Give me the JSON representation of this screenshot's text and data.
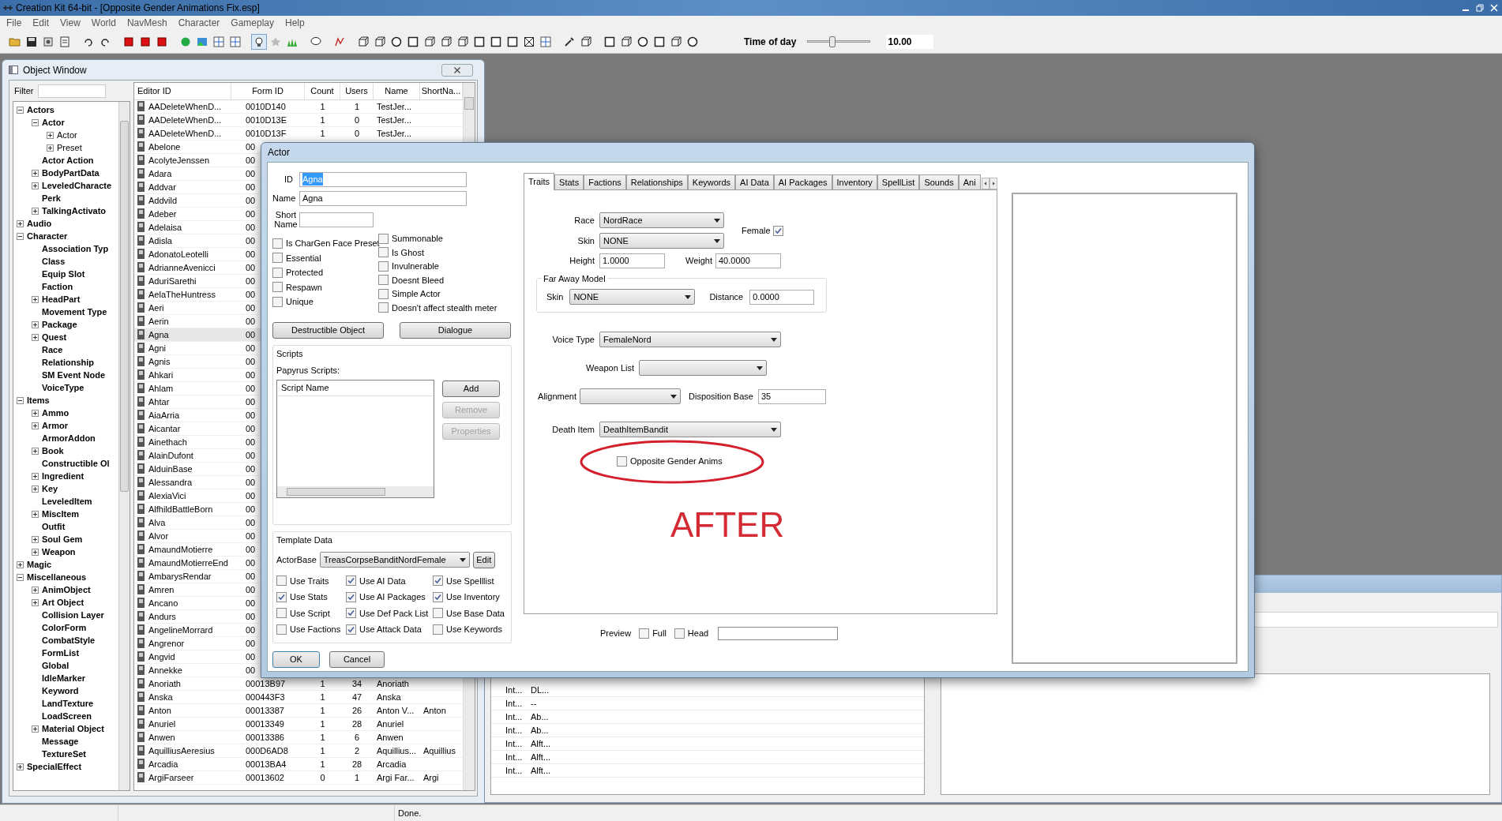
{
  "window": {
    "title": "Creation Kit 64-bit - [Opposite Gender Animations Fix.esp]"
  },
  "menu": [
    "File",
    "Edit",
    "View",
    "World",
    "NavMesh",
    "Character",
    "Gameplay",
    "Help"
  ],
  "toolbar": {
    "time_label": "Time of day",
    "time_slider": {
      "level": 0.4
    },
    "time_value": "10.00"
  },
  "object_window": {
    "title": "Object Window",
    "filter_label": "Filter",
    "tree": [
      {
        "label": "Actors",
        "expanded": true,
        "children": [
          {
            "label": "Actor",
            "expanded": true,
            "children": [
              {
                "label": "Actor",
                "expanded": false
              },
              {
                "label": "Preset",
                "expanded": false
              }
            ]
          },
          {
            "label": "Actor Action"
          },
          {
            "label": "BodyPartData",
            "expanded": false
          },
          {
            "label": "LeveledCharacte",
            "expanded": false
          },
          {
            "label": "Perk"
          },
          {
            "label": "TalkingActivato",
            "expanded": false
          }
        ]
      },
      {
        "label": "Audio",
        "expanded": false
      },
      {
        "label": "Character",
        "expanded": true,
        "children": [
          {
            "label": "Association Typ"
          },
          {
            "label": "Class"
          },
          {
            "label": "Equip Slot"
          },
          {
            "label": "Faction"
          },
          {
            "label": "HeadPart",
            "expanded": false
          },
          {
            "label": "Movement Type"
          },
          {
            "label": "Package",
            "expanded": false
          },
          {
            "label": "Quest",
            "expanded": false
          },
          {
            "label": "Race"
          },
          {
            "label": "Relationship"
          },
          {
            "label": "SM Event Node"
          },
          {
            "label": "VoiceType"
          }
        ]
      },
      {
        "label": "Items",
        "expanded": true,
        "children": [
          {
            "label": "Ammo",
            "expanded": false
          },
          {
            "label": "Armor",
            "expanded": false
          },
          {
            "label": "ArmorAddon"
          },
          {
            "label": "Book",
            "expanded": false
          },
          {
            "label": "Constructible Ol"
          },
          {
            "label": "Ingredient",
            "expanded": false
          },
          {
            "label": "Key",
            "expanded": false
          },
          {
            "label": "LeveledItem"
          },
          {
            "label": "MiscItem",
            "expanded": false
          },
          {
            "label": "Outfit"
          },
          {
            "label": "Soul Gem",
            "expanded": false
          },
          {
            "label": "Weapon",
            "expanded": false
          }
        ]
      },
      {
        "label": "Magic",
        "expanded": false
      },
      {
        "label": "Miscellaneous",
        "expanded": true,
        "children": [
          {
            "label": "AnimObject",
            "expanded": false
          },
          {
            "label": "Art Object",
            "expanded": false
          },
          {
            "label": "Collision Layer"
          },
          {
            "label": "ColorForm"
          },
          {
            "label": "CombatStyle"
          },
          {
            "label": "FormList"
          },
          {
            "label": "Global"
          },
          {
            "label": "IdleMarker"
          },
          {
            "label": "Keyword"
          },
          {
            "label": "LandTexture"
          },
          {
            "label": "LoadScreen"
          },
          {
            "label": "Material Object",
            "expanded": false
          },
          {
            "label": "Message"
          },
          {
            "label": "TextureSet"
          }
        ]
      },
      {
        "label": "SpecialEffect",
        "expanded": false
      }
    ],
    "columns": [
      "Editor ID",
      "Form ID",
      "Count",
      "Users",
      "Name",
      "ShortNa..."
    ],
    "rows": [
      {
        "cells": [
          "AADeleteWhenD...",
          "0010D140",
          "1",
          "1",
          "TestJer..."
        ],
        "selected": false
      },
      {
        "cells": [
          "AADeleteWhenD...",
          "0010D13E",
          "1",
          "0",
          "TestJer..."
        ],
        "selected": false
      },
      {
        "cells": [
          "AADeleteWhenD...",
          "0010D13F",
          "1",
          "0",
          "TestJer..."
        ],
        "selected": false
      },
      {
        "cells": [
          "Abelone",
          "00"
        ],
        "selected": false
      },
      {
        "cells": [
          "AcolyteJenssen",
          "00"
        ],
        "selected": false
      },
      {
        "cells": [
          "Adara",
          "00"
        ],
        "selected": false
      },
      {
        "cells": [
          "Addvar",
          "00"
        ],
        "selected": false
      },
      {
        "cells": [
          "Addvild",
          "00"
        ],
        "selected": false
      },
      {
        "cells": [
          "Adeber",
          "00"
        ],
        "selected": false
      },
      {
        "cells": [
          "Adelaisa",
          "00"
        ],
        "selected": false
      },
      {
        "cells": [
          "Adisla",
          "00"
        ],
        "selected": false
      },
      {
        "cells": [
          "AdonatoLeotelli",
          "00"
        ],
        "selected": false
      },
      {
        "cells": [
          "AdrianneAvenicci",
          "00"
        ],
        "selected": false
      },
      {
        "cells": [
          "AduriSarethi",
          "00"
        ],
        "selected": false
      },
      {
        "cells": [
          "AelaTheHuntress",
          "00"
        ],
        "selected": false
      },
      {
        "cells": [
          "Aeri",
          "00"
        ],
        "selected": false
      },
      {
        "cells": [
          "Aerin",
          "00"
        ],
        "selected": false
      },
      {
        "cells": [
          "Agna",
          "00"
        ],
        "selected": true
      },
      {
        "cells": [
          "Agni",
          "00"
        ],
        "selected": false
      },
      {
        "cells": [
          "Agnis",
          "00"
        ],
        "selected": false
      },
      {
        "cells": [
          "Ahkari",
          "00"
        ],
        "selected": false
      },
      {
        "cells": [
          "Ahlam",
          "00"
        ],
        "selected": false
      },
      {
        "cells": [
          "Ahtar",
          "00"
        ],
        "selected": false
      },
      {
        "cells": [
          "AiaArria",
          "00"
        ],
        "selected": false
      },
      {
        "cells": [
          "Aicantar",
          "00"
        ],
        "selected": false
      },
      {
        "cells": [
          "Ainethach",
          "00"
        ],
        "selected": false
      },
      {
        "cells": [
          "AlainDufont",
          "00"
        ],
        "selected": false
      },
      {
        "cells": [
          "AlduinBase",
          "00"
        ],
        "selected": false
      },
      {
        "cells": [
          "Alessandra",
          "00"
        ],
        "selected": false
      },
      {
        "cells": [
          "AlexiaVici",
          "00"
        ],
        "selected": false
      },
      {
        "cells": [
          "AlfhildBattleBorn",
          "00"
        ],
        "selected": false
      },
      {
        "cells": [
          "Alva",
          "00"
        ],
        "selected": false
      },
      {
        "cells": [
          "Alvor",
          "00"
        ],
        "selected": false
      },
      {
        "cells": [
          "AmaundMotierre",
          "00"
        ],
        "selected": false
      },
      {
        "cells": [
          "AmaundMotierreEnd",
          "00"
        ],
        "selected": false
      },
      {
        "cells": [
          "AmbarysRendar",
          "00"
        ],
        "selected": false
      },
      {
        "cells": [
          "Amren",
          "00"
        ],
        "selected": false
      },
      {
        "cells": [
          "Ancano",
          "00"
        ],
        "selected": false
      },
      {
        "cells": [
          "Andurs",
          "00"
        ],
        "selected": false
      },
      {
        "cells": [
          "AngelineMorrard",
          "00"
        ],
        "selected": false
      },
      {
        "cells": [
          "Angrenor",
          "00"
        ],
        "selected": false
      },
      {
        "cells": [
          "Angvid",
          "00"
        ],
        "selected": false
      },
      {
        "cells": [
          "Annekke",
          "00"
        ],
        "selected": false
      },
      {
        "cells": [
          "Anoriath",
          "00013B97",
          "1",
          "34",
          "Anoriath"
        ],
        "selected": false
      },
      {
        "cells": [
          "Anska",
          "000443F3",
          "1",
          "47",
          "Anska"
        ],
        "selected": false
      },
      {
        "cells": [
          "Anton",
          "00013387",
          "1",
          "26",
          "Anton V...",
          "Anton"
        ],
        "selected": false
      },
      {
        "cells": [
          "Anuriel",
          "00013349",
          "1",
          "28",
          "Anuriel"
        ],
        "selected": false
      },
      {
        "cells": [
          "Anwen",
          "00013386",
          "1",
          "6",
          "Anwen"
        ],
        "selected": false
      },
      {
        "cells": [
          "AquilliusAeresius",
          "000D6AD8",
          "1",
          "2",
          "Aquillius...",
          "Aquillius"
        ],
        "selected": false
      },
      {
        "cells": [
          "Arcadia",
          "00013BA4",
          "1",
          "28",
          "Arcadia"
        ],
        "selected": false
      },
      {
        "cells": [
          "ArgiFarseer",
          "00013602",
          "0",
          "1",
          "Argi Far...",
          "Argi"
        ],
        "selected": false
      }
    ]
  },
  "cell_view": {
    "rows": [
      [
        "Int...",
        "DL..."
      ],
      [
        "Int...",
        "--"
      ],
      [
        "Int...",
        "Ab..."
      ],
      [
        "Int...",
        "Ab..."
      ],
      [
        "Int...",
        "Alft..."
      ],
      [
        "Int...",
        "Alft..."
      ],
      [
        "Int...",
        "Alft..."
      ]
    ]
  },
  "actor_dialog": {
    "title": "Actor",
    "id": {
      "label": "ID",
      "value": "Agna"
    },
    "name": {
      "label": "Name",
      "value": "Agna"
    },
    "short_name": {
      "label": "Short Name"
    },
    "flags_left": [
      {
        "label": "Is CharGen Face Preset",
        "checked": false
      },
      {
        "label": "Essential",
        "checked": false
      },
      {
        "label": "Protected",
        "checked": false
      },
      {
        "label": "Respawn",
        "checked": false
      },
      {
        "label": "Unique",
        "checked": false
      }
    ],
    "flags_right": [
      {
        "label": "Summonable",
        "checked": false
      },
      {
        "label": "Is Ghost",
        "checked": false
      },
      {
        "label": "Invulnerable",
        "checked": false
      },
      {
        "label": "Doesnt Bleed",
        "checked": false
      },
      {
        "label": "Simple Actor",
        "checked": false
      },
      {
        "label": "Doesn't affect stealth meter",
        "checked": false
      }
    ],
    "buttons": [
      "Destructible Object",
      "Dialogue"
    ],
    "scripts": {
      "title": "Scripts",
      "subtitle": "Papyrus Scripts:",
      "column": "Script Name",
      "buttons": [
        {
          "label": "Add",
          "disabled": false
        },
        {
          "label": "Remove",
          "disabled": true
        },
        {
          "label": "Properties",
          "disabled": true
        }
      ]
    },
    "template": {
      "title": "Template Data",
      "actor_base_label": "ActorBase",
      "actor_base": "TreasCorpseBanditNordFemale",
      "edit": "Edit",
      "flags": [
        {
          "label": "Use Traits",
          "checked": false
        },
        {
          "label": "Use AI Data",
          "checked": true
        },
        {
          "label": "Use Spelllist",
          "checked": true
        },
        {
          "label": "Use Stats",
          "checked": true
        },
        {
          "label": "Use AI Packages",
          "checked": true
        },
        {
          "label": "Use Inventory",
          "checked": true
        },
        {
          "label": "Use Script",
          "checked": false
        },
        {
          "label": "Use Def Pack List",
          "checked": true
        },
        {
          "label": "Use Base Data",
          "checked": false
        },
        {
          "label": "Use Factions",
          "checked": false
        },
        {
          "label": "Use Attack Data",
          "checked": true
        },
        {
          "label": "Use Keywords",
          "checked": false
        }
      ]
    },
    "ok": "OK",
    "cancel": "Cancel",
    "tabs": [
      {
        "label": "Traits",
        "selected": true
      },
      {
        "label": "Stats",
        "selected": false
      },
      {
        "label": "Factions",
        "selected": false
      },
      {
        "label": "Relationships",
        "selected": false
      },
      {
        "label": "Keywords",
        "selected": false
      },
      {
        "label": "AI Data",
        "selected": false
      },
      {
        "label": "AI Packages",
        "selected": false
      },
      {
        "label": "Inventory",
        "selected": false
      },
      {
        "label": "SpellList",
        "selected": false
      },
      {
        "label": "Sounds",
        "selected": false
      },
      {
        "label": "Ani",
        "selected": false
      }
    ],
    "traits": {
      "race": {
        "label": "Race",
        "value": "NordRace"
      },
      "female": {
        "label": "Female",
        "checked": true
      },
      "skin": {
        "label": "Skin",
        "value": "NONE"
      },
      "height": {
        "label": "Height",
        "value": "1.0000"
      },
      "weight": {
        "label": "Weight",
        "value": "40.0000"
      },
      "far_away_model": {
        "title": "Far Away Model",
        "skin_label": "Skin",
        "skin": "NONE",
        "distance_label": "Distance",
        "distance": "0.0000"
      },
      "voice_type": {
        "label": "Voice Type",
        "value": "FemaleNord"
      },
      "weapon_list": {
        "label": "Weapon List"
      },
      "alignment": {
        "label": "Alignment"
      },
      "disposition_base": {
        "label": "Disposition Base",
        "value": "35"
      },
      "death_item": {
        "label": "Death Item",
        "value": "DeathItemBandit"
      },
      "opposite_gender_anims": {
        "label": "Opposite Gender Anims",
        "checked": false
      }
    },
    "annotation": "AFTER",
    "preview": {
      "label": "Preview",
      "full": {
        "label": "Full",
        "checked": false
      },
      "head": {
        "label": "Head",
        "checked": false
      }
    }
  },
  "status_bar": {
    "text": "Done."
  }
}
